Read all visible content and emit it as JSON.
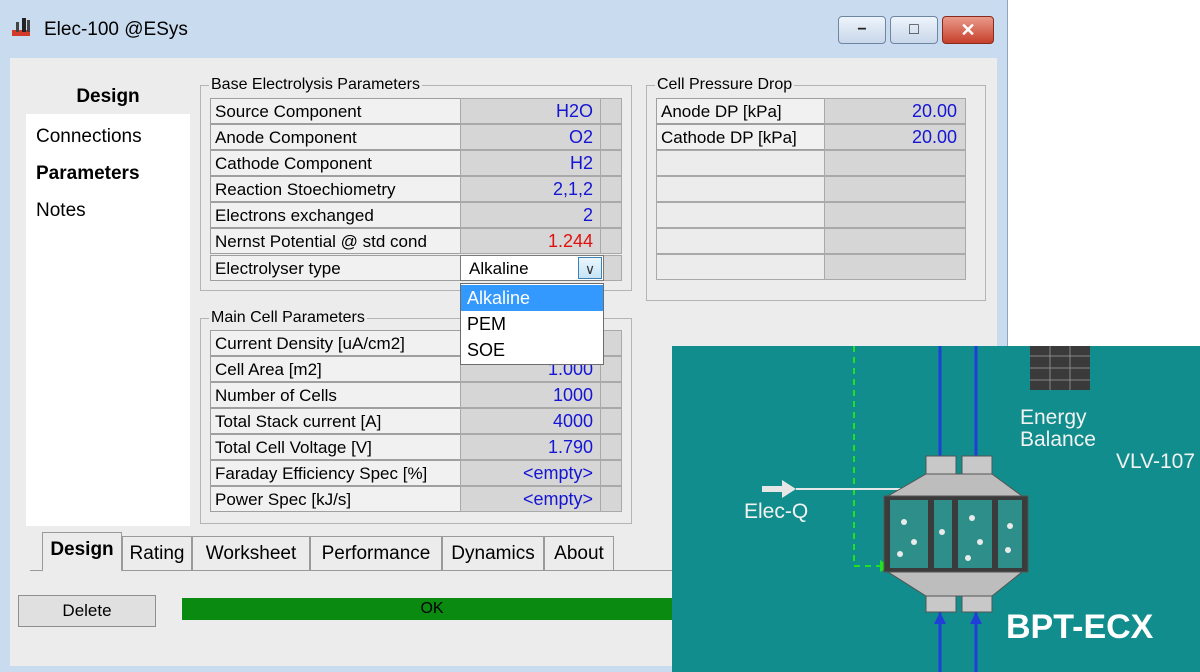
{
  "window": {
    "title": "Elec-100 @ESys",
    "min_glyph": "−",
    "max_glyph": "□",
    "close_glyph": "✕"
  },
  "nav": {
    "header": "Design",
    "items": [
      "Connections",
      "Parameters",
      "Notes"
    ],
    "active": "Parameters"
  },
  "base_params": {
    "title": "Base Electrolysis Parameters",
    "rows": [
      {
        "label": "Source Component",
        "value": "H2O"
      },
      {
        "label": "Anode Component",
        "value": "O2"
      },
      {
        "label": "Cathode Component",
        "value": "H2"
      },
      {
        "label": "Reaction Stoechiometry",
        "value": "2,1,2"
      },
      {
        "label": "Electrons exchanged",
        "value": "2"
      },
      {
        "label": "Nernst Potential @ std cond",
        "value": "1.244"
      },
      {
        "label": "Electrolyser type",
        "value": "Alkaline"
      }
    ],
    "dropdown_glyph": "∨",
    "options": [
      "Alkaline",
      "PEM",
      "SOE"
    ],
    "selected_option": "Alkaline"
  },
  "pressure_drop": {
    "title": "Cell Pressure Drop",
    "rows": [
      {
        "label": "Anode DP [kPa]",
        "value": "20.00"
      },
      {
        "label": "Cathode DP [kPa]",
        "value": "20.00"
      }
    ]
  },
  "main_cell": {
    "title": "Main Cell Parameters",
    "rows": [
      {
        "label": "Current Density [uA/cm2]",
        "value": ""
      },
      {
        "label": "Cell Area [m2]",
        "value": "1.000"
      },
      {
        "label": "Number of Cells",
        "value": "1000"
      },
      {
        "label": "Total Stack current [A]",
        "value": "4000"
      },
      {
        "label": "Total Cell Voltage [V]",
        "value": "1.790"
      },
      {
        "label": "Faraday Efficiency Spec [%]",
        "value": "<empty>"
      },
      {
        "label": "Power Spec [kJ/s]",
        "value": "<empty>"
      }
    ]
  },
  "tabs": [
    "Design",
    "Rating",
    "Worksheet",
    "Performance",
    "Dynamics",
    "About"
  ],
  "active_tab": "Design",
  "footer": {
    "delete_label": "Delete",
    "status_text": "OK"
  },
  "diagram": {
    "energy_label_1": "Energy",
    "energy_label_2": "Balance",
    "valve_label": "VLV-107",
    "stream_label": "Elec-Q",
    "unit_label": "BPT-ECX"
  },
  "colors": {
    "value_text": "#1515d4",
    "warning_value": "#e01010",
    "status_ok": "#0a8a10",
    "selection": "#3399ff",
    "diagram_bg": "#108d8c",
    "stream_blue": "#1f3fd8",
    "energy_dash": "#22e022"
  }
}
